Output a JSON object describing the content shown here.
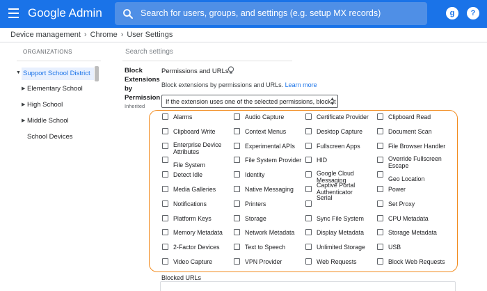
{
  "header": {
    "brand": "Google Admin",
    "search_placeholder": "Search for users, groups, and settings (e.g. setup MX records)",
    "account_initial": "g",
    "help_label": "?"
  },
  "breadcrumb": [
    "Device management",
    "Chrome",
    "User Settings"
  ],
  "sidebar": {
    "heading": "ORGANIZATIONS",
    "items": [
      {
        "label": "Support School District",
        "selected": true
      },
      {
        "label": "Elementary School"
      },
      {
        "label": "High School"
      },
      {
        "label": "Middle School"
      },
      {
        "label": "School Devices"
      }
    ]
  },
  "main": {
    "search_placeholder": "Search settings",
    "setting_name": "Block Extensions by Permission",
    "inherited": "Inherited",
    "section_title": "Permissions and URLs",
    "description": "Block extensions by permissions and URLs.",
    "learn_more": "Learn more",
    "select_value": "If the extension uses one of the selected permissions, block it",
    "permissions": [
      [
        "Alarms",
        "Audio Capture",
        "Certificate Provider",
        "Clipboard Read"
      ],
      [
        "Clipboard Write",
        "Context Menus",
        "Desktop Capture",
        "Document Scan"
      ],
      [
        "Enterprise Device Attributes",
        "Experimental APIs",
        "Fullscreen Apps",
        "File Browser Handler"
      ],
      [
        "File System",
        "File System Provider",
        "HID",
        "Override Fullscreen Escape"
      ],
      [
        "Detect Idle",
        "Identity",
        "Google Cloud Messaging",
        "Geo Location"
      ],
      [
        "Media Galleries",
        "Native Messaging",
        "Captive Portal Authenticator",
        "Power"
      ],
      [
        "Notifications",
        "Printers",
        "Serial",
        "Set Proxy"
      ],
      [
        "Platform Keys",
        "Storage",
        "Sync File System",
        "CPU Metadata"
      ],
      [
        "Memory Metadata",
        "Network Metadata",
        "Display Metadata",
        "Storage Metadata"
      ],
      [
        "2-Factor Devices",
        "Text to Speech",
        "Unlimited Storage",
        "USB"
      ],
      [
        "Video Capture",
        "VPN Provider",
        "Web Requests",
        "Block Web Requests"
      ]
    ],
    "blocked_urls_label": "Blocked URLs"
  },
  "colors": {
    "topbar": "#1a73e8",
    "highlight_outline": "#f28b1e",
    "link": "#1a73e8"
  }
}
